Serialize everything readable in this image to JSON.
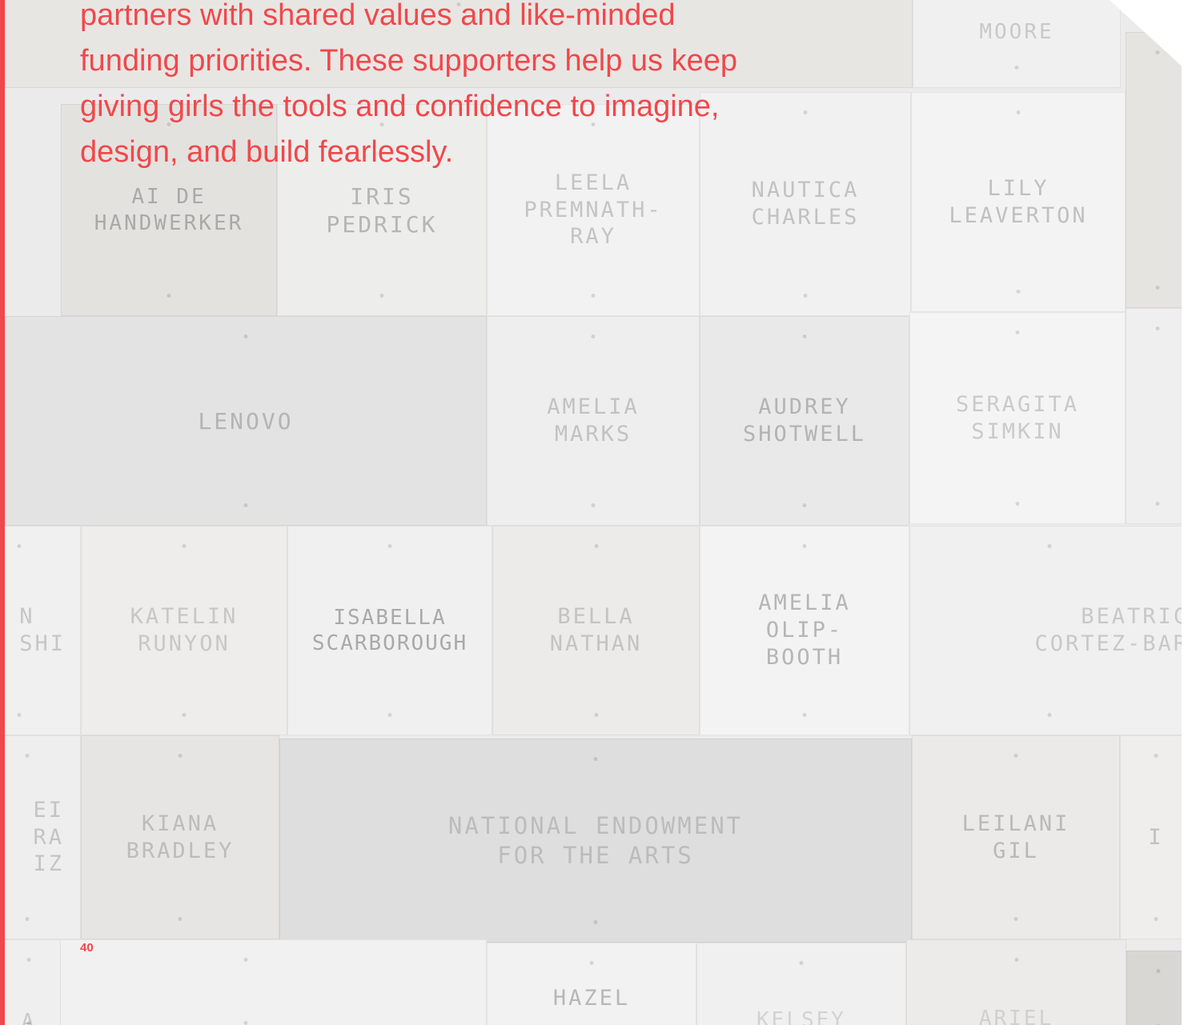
{
  "intro_lines": [
    "partners with shared values and like-minded",
    "funding priorities. These supporters help us keep",
    "giving girls the tools and confidence to imagine,",
    "design, and build fearlessly."
  ],
  "page_number": "40",
  "colors": {
    "accent": "#f0484b",
    "wall": "#ebebeb"
  },
  "plaques": [
    "MOORE",
    "AI DE\nHANDWERKER",
    "IRIS\nPEDRICK",
    "LEELA\nPREMNATH-\nRAY",
    "NAUTICA\nCHARLES",
    "LILY\nLEAVERTON",
    "LENOVO",
    "AMELIA\nMARKS",
    "AUDREY\nSHOTWELL",
    "SERAGITA\nSIMKIN",
    "N\nSHI",
    "KATELIN\nRUNYON",
    "ISABELLA\nSCARBOROUGH",
    "BELLA\nNATHAN",
    "AMELIA\nOLIP-\nBOOTH",
    "BEATRIC\nCORTEZ-BAR",
    "EI\nRA\nIZ",
    "KIANA\nBRADLEY",
    "NATIONAL ENDOWMENT\nFOR THE ARTS",
    "LEILANI\nGIL",
    "I",
    "HAZEL",
    "KELSEY",
    "ARIEL",
    "A"
  ]
}
